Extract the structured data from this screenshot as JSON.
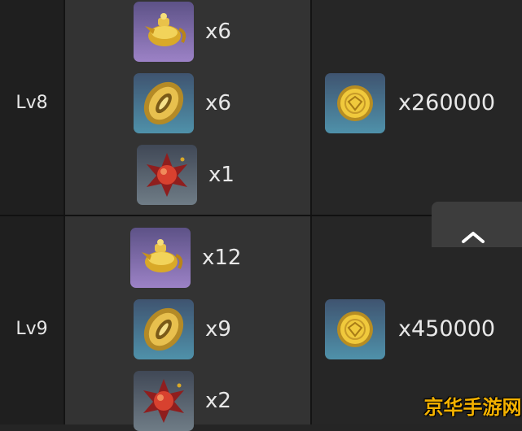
{
  "levels": [
    {
      "label": "Lv8",
      "materials": [
        {
          "icon": "golden-teapot-icon",
          "quantity": "x6"
        },
        {
          "icon": "golden-ornament-icon",
          "quantity": "x6"
        },
        {
          "icon": "red-crystal-icon",
          "quantity": "x1"
        }
      ],
      "cost": {
        "icon": "gold-coin-icon",
        "quantity": "x260000"
      }
    },
    {
      "label": "Lv9",
      "materials": [
        {
          "icon": "golden-teapot-icon",
          "quantity": "x12"
        },
        {
          "icon": "golden-ornament-icon",
          "quantity": "x9"
        },
        {
          "icon": "red-crystal-icon",
          "quantity": "x2"
        }
      ],
      "cost": {
        "icon": "gold-coin-icon",
        "quantity": "x450000"
      }
    }
  ],
  "scroll_to_top": {
    "icon": "chevron-up-icon"
  },
  "watermark": {
    "text": "京华手游网"
  },
  "colors": {
    "purple_frame": "#9c82c6",
    "blue_frame": "#4f91aa",
    "gray_frame": "#6f7c86",
    "gold": "#e0b84a",
    "watermark": "#f3b100"
  }
}
